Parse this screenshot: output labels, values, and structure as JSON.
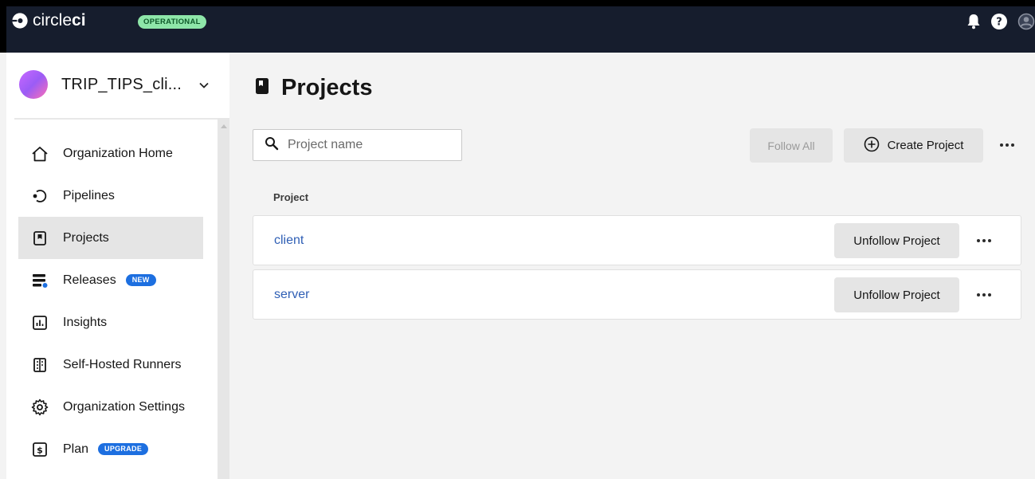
{
  "header": {
    "logo_text": "circleci",
    "status_badge": "OPERATIONAL",
    "icons": [
      "bell-icon",
      "help-icon",
      "user-avatar-icon"
    ]
  },
  "sidebar": {
    "org_name": "TRIP_TIPS_cli...",
    "items": [
      {
        "label": "Organization Home",
        "icon": "home-icon"
      },
      {
        "label": "Pipelines",
        "icon": "pipelines-icon"
      },
      {
        "label": "Projects",
        "icon": "projects-icon",
        "active": true
      },
      {
        "label": "Releases",
        "icon": "releases-icon",
        "badge": "NEW"
      },
      {
        "label": "Insights",
        "icon": "insights-icon"
      },
      {
        "label": "Self-Hosted Runners",
        "icon": "runners-icon"
      },
      {
        "label": "Organization Settings",
        "icon": "gear-icon"
      },
      {
        "label": "Plan",
        "icon": "plan-icon",
        "badge": "UPGRADE"
      }
    ]
  },
  "main": {
    "title": "Projects",
    "search_placeholder": "Project name",
    "follow_all_label": "Follow All",
    "create_project_label": "Create Project",
    "column_header": "Project",
    "projects": [
      {
        "name": "client",
        "action": "Unfollow Project"
      },
      {
        "name": "server",
        "action": "Unfollow Project"
      }
    ]
  },
  "colors": {
    "topbar": "#161d2d",
    "status_badge_bg": "#8ee6a9",
    "pill_blue": "#1d6fe0",
    "link_blue": "#2f5fb5"
  }
}
